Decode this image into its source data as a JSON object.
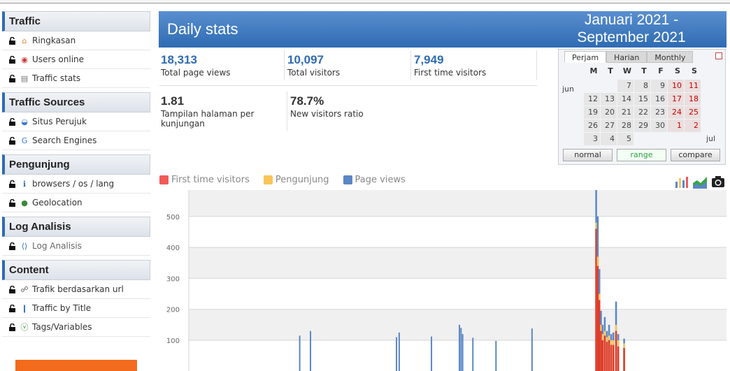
{
  "sidebar": {
    "sections": [
      {
        "title": "Traffic",
        "items": [
          {
            "label": "Ringkasan",
            "icon": "home-icon"
          },
          {
            "label": "Users online",
            "icon": "live-icon"
          },
          {
            "label": "Traffic stats",
            "icon": "calendar-icon"
          }
        ]
      },
      {
        "title": "Traffic Sources",
        "items": [
          {
            "label": "Situs Perujuk",
            "icon": "referrer-icon"
          },
          {
            "label": "Search Engines",
            "icon": "google-icon"
          }
        ]
      },
      {
        "title": "Pengunjung",
        "items": [
          {
            "label": "browsers / os / lang",
            "icon": "info-icon"
          },
          {
            "label": "Geolocation",
            "icon": "globe-icon"
          }
        ]
      },
      {
        "title": "Log Analisis",
        "items": [
          {
            "label": "Log Analisis",
            "icon": "code-icon"
          }
        ]
      },
      {
        "title": "Content",
        "items": [
          {
            "label": "Trafik berdasarkan url",
            "icon": "link-icon"
          },
          {
            "label": "Traffic by Title",
            "icon": "title-icon"
          },
          {
            "label": "Tags/Variables",
            "icon": "tag-icon"
          }
        ]
      }
    ]
  },
  "header": {
    "title": "Daily stats",
    "period_line1": "Januari 2021 -",
    "period_line2": "September 2021"
  },
  "stats": {
    "page_views": {
      "value": "18,313",
      "label": "Total page views"
    },
    "total_visitors": {
      "value": "10,097",
      "label": "Total visitors"
    },
    "first_time": {
      "value": "7,949",
      "label": "First time visitors"
    },
    "pages_per_visit": {
      "value": "1.81",
      "label_line1": "Tampilan halaman per",
      "label_line2": "kunjungan"
    },
    "new_ratio": {
      "value": "78.7%",
      "label": "New visitors ratio"
    }
  },
  "calendar": {
    "tabs": [
      "Perjam",
      "Harian",
      "Monthly"
    ],
    "active_tab": "Perjam",
    "weekdays": [
      "M",
      "T",
      "W",
      "T",
      "F",
      "S",
      "S"
    ],
    "month_left": "jun",
    "month_right": "jul",
    "rows": [
      [
        "",
        "",
        "7",
        "8",
        "9",
        "10",
        "11"
      ],
      [
        "12",
        "13",
        "14",
        "15",
        "16",
        "17",
        "18"
      ],
      [
        "19",
        "20",
        "21",
        "22",
        "23",
        "24",
        "25"
      ],
      [
        "26",
        "27",
        "28",
        "29",
        "30",
        "1",
        "2"
      ],
      [
        "3",
        "4",
        "5",
        "",
        "",
        "",
        ""
      ]
    ],
    "buttons": [
      "normal",
      "range",
      "compare"
    ],
    "active_button": "range"
  },
  "legend": [
    {
      "label": "First time visitors",
      "color": "#f05a5a"
    },
    {
      "label": "Pengunjung",
      "color": "#f8c55a"
    },
    {
      "label": "Page views",
      "color": "#5b87c5"
    }
  ],
  "colors": {
    "accent": "#2f6bb3",
    "orange": "#f36b1c"
  },
  "chart_data": {
    "type": "bar",
    "yticks": [
      100,
      200,
      300,
      400,
      500,
      600
    ],
    "ylim": [
      0,
      650
    ],
    "grid": true,
    "series": [
      {
        "name": "Page views",
        "color": "#5b87c5",
        "values": [
          0,
          0,
          0,
          0,
          0,
          0,
          0,
          0,
          0,
          0,
          0,
          0,
          0,
          0,
          0,
          0,
          0,
          0,
          0,
          0,
          0,
          0,
          0,
          0,
          0,
          0,
          0,
          0,
          0,
          0,
          0,
          0,
          0,
          0,
          0,
          0,
          0,
          0,
          0,
          0,
          0,
          0,
          0,
          0,
          0,
          0,
          0,
          0,
          0,
          0,
          0,
          0,
          0,
          0,
          0,
          0,
          0,
          0,
          0,
          0,
          0,
          0,
          0,
          0,
          0,
          0,
          0,
          0,
          0,
          0,
          0,
          0,
          0,
          0,
          0,
          0,
          0,
          0,
          0,
          0,
          0,
          0,
          0,
          0,
          0,
          0,
          0,
          0,
          0,
          0,
          0,
          0,
          0,
          0,
          0,
          0,
          0,
          0,
          0,
          0,
          0,
          0,
          0,
          0,
          0,
          0,
          0,
          0,
          0,
          0,
          0,
          0,
          0,
          0,
          0,
          0,
          0,
          0,
          0,
          0,
          0,
          0,
          0,
          0,
          0,
          0,
          0,
          0,
          0,
          0,
          0,
          0,
          0,
          0,
          0,
          0,
          0,
          0,
          0,
          0,
          0,
          0,
          0,
          0,
          0,
          0,
          0,
          0,
          0,
          0,
          0,
          0,
          0,
          0,
          0,
          0,
          0,
          0,
          0,
          0,
          0,
          0,
          0,
          0,
          0,
          0,
          0,
          0,
          0,
          0,
          0,
          0,
          0,
          0,
          0,
          0,
          0,
          0,
          0,
          0,
          0,
          0,
          0,
          0,
          0,
          0,
          0,
          0,
          0,
          0,
          0,
          0,
          0,
          0,
          0,
          0,
          0,
          0,
          0,
          0,
          0,
          0,
          0,
          0,
          0,
          0,
          0,
          0,
          0,
          0,
          0,
          0,
          0,
          0,
          0,
          0,
          0,
          0,
          0,
          0,
          0,
          0,
          0,
          0,
          0,
          0,
          0,
          0,
          0,
          0,
          0,
          0,
          0,
          0,
          0,
          0,
          0,
          0,
          0,
          0,
          0,
          0,
          0,
          0,
          0,
          0,
          0,
          0,
          0,
          0,
          0,
          0,
          0,
          0,
          0,
          0,
          0,
          0,
          0,
          0,
          0,
          0,
          0,
          0,
          0,
          0,
          0
        ]
      }
    ],
    "visible_bars": [
      {
        "x": 0.205,
        "v": 115
      },
      {
        "x": 0.225,
        "v": 130
      },
      {
        "x": 0.385,
        "v": 110
      },
      {
        "x": 0.39,
        "v": 125
      },
      {
        "x": 0.45,
        "v": 112
      },
      {
        "x": 0.502,
        "v": 150
      },
      {
        "x": 0.505,
        "v": 140
      },
      {
        "x": 0.508,
        "v": 120
      },
      {
        "x": 0.527,
        "v": 108
      },
      {
        "x": 0.57,
        "v": 98
      },
      {
        "x": 0.637,
        "v": 138
      }
    ],
    "spike_bars": [
      {
        "x": 0.756,
        "pv": 640,
        "pg": 480,
        "ft": 460
      },
      {
        "x": 0.759,
        "pv": 500,
        "pg": 370,
        "ft": 340
      },
      {
        "x": 0.762,
        "pv": 330,
        "pg": 250,
        "ft": 230
      },
      {
        "x": 0.765,
        "pv": 195,
        "pg": 150,
        "ft": 130
      },
      {
        "x": 0.768,
        "pv": 150,
        "pg": 120,
        "ft": 100
      },
      {
        "x": 0.772,
        "pv": 175,
        "pg": 130,
        "ft": 115
      },
      {
        "x": 0.776,
        "pv": 130,
        "pg": 110,
        "ft": 95
      },
      {
        "x": 0.78,
        "pv": 150,
        "pg": 115,
        "ft": 100
      },
      {
        "x": 0.784,
        "pv": 120,
        "pg": 100,
        "ft": 85
      },
      {
        "x": 0.788,
        "pv": 125,
        "pg": 100,
        "ft": 85
      },
      {
        "x": 0.793,
        "pv": 225,
        "pg": 150,
        "ft": 130
      },
      {
        "x": 0.797,
        "pv": 120,
        "pg": 100,
        "ft": 80
      },
      {
        "x": 0.808,
        "pv": 105,
        "pg": 90,
        "ft": 75
      }
    ]
  }
}
